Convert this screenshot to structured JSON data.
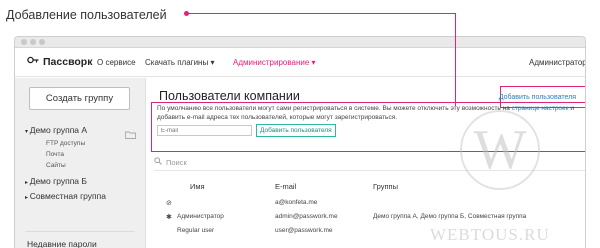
{
  "caption": "Добавление пользователей",
  "window": {
    "navbar": {
      "logo": "Пассворк",
      "items": [
        "О сервисе",
        "Скачать плагины ▾",
        "Администрирование ▾"
      ],
      "user_menu": "Администратор ▾"
    },
    "sidebar": {
      "create_button": "Создать группу",
      "groups": [
        {
          "label": "Демо группа А",
          "expanded": true,
          "active": true,
          "subitems": [
            "FTP доступы",
            "Почта",
            "Сайты"
          ]
        },
        {
          "label": "Демо группа Б",
          "expanded": false
        },
        {
          "label": "Совместная группа",
          "expanded": false
        }
      ],
      "recent": "Недавние пароли"
    },
    "main": {
      "title": "Пользователи компании",
      "add_user_button": "Добавить пользователя",
      "notice_text": "По умолчанию все пользователи могут сами регистрироваться в системе. Вы можете отключить эту возможность на",
      "notice_link": "странице настроек",
      "notice_tail": "и",
      "notice_line2": "добавить e-mail адреса тех пользователей, которые могут зарегистрироваться.",
      "email_placeholder": "E-mail",
      "inline_add_button": "Добавить пользователя",
      "search_placeholder": "Поиск",
      "table": {
        "headers": [
          "Имя",
          "E-mail",
          "Группы"
        ],
        "rows": [
          {
            "icon": "⊘",
            "name": "",
            "email": "a@konfeta.me",
            "groups": ""
          },
          {
            "icon": "✱",
            "name": "Администратор",
            "email": "admin@passwork.me",
            "groups": "Демо группа А, Демо группа Б, Совместная группа"
          },
          {
            "icon": "",
            "name": "Regular user",
            "email": "user@passwork.me",
            "groups": ""
          }
        ]
      }
    }
  },
  "watermark": {
    "letter": "W",
    "text": "WEBTOUS.RU"
  },
  "colors": {
    "accent": "#e0247a",
    "link": "#2a7fb8",
    "teal": "#2cb8a4"
  }
}
